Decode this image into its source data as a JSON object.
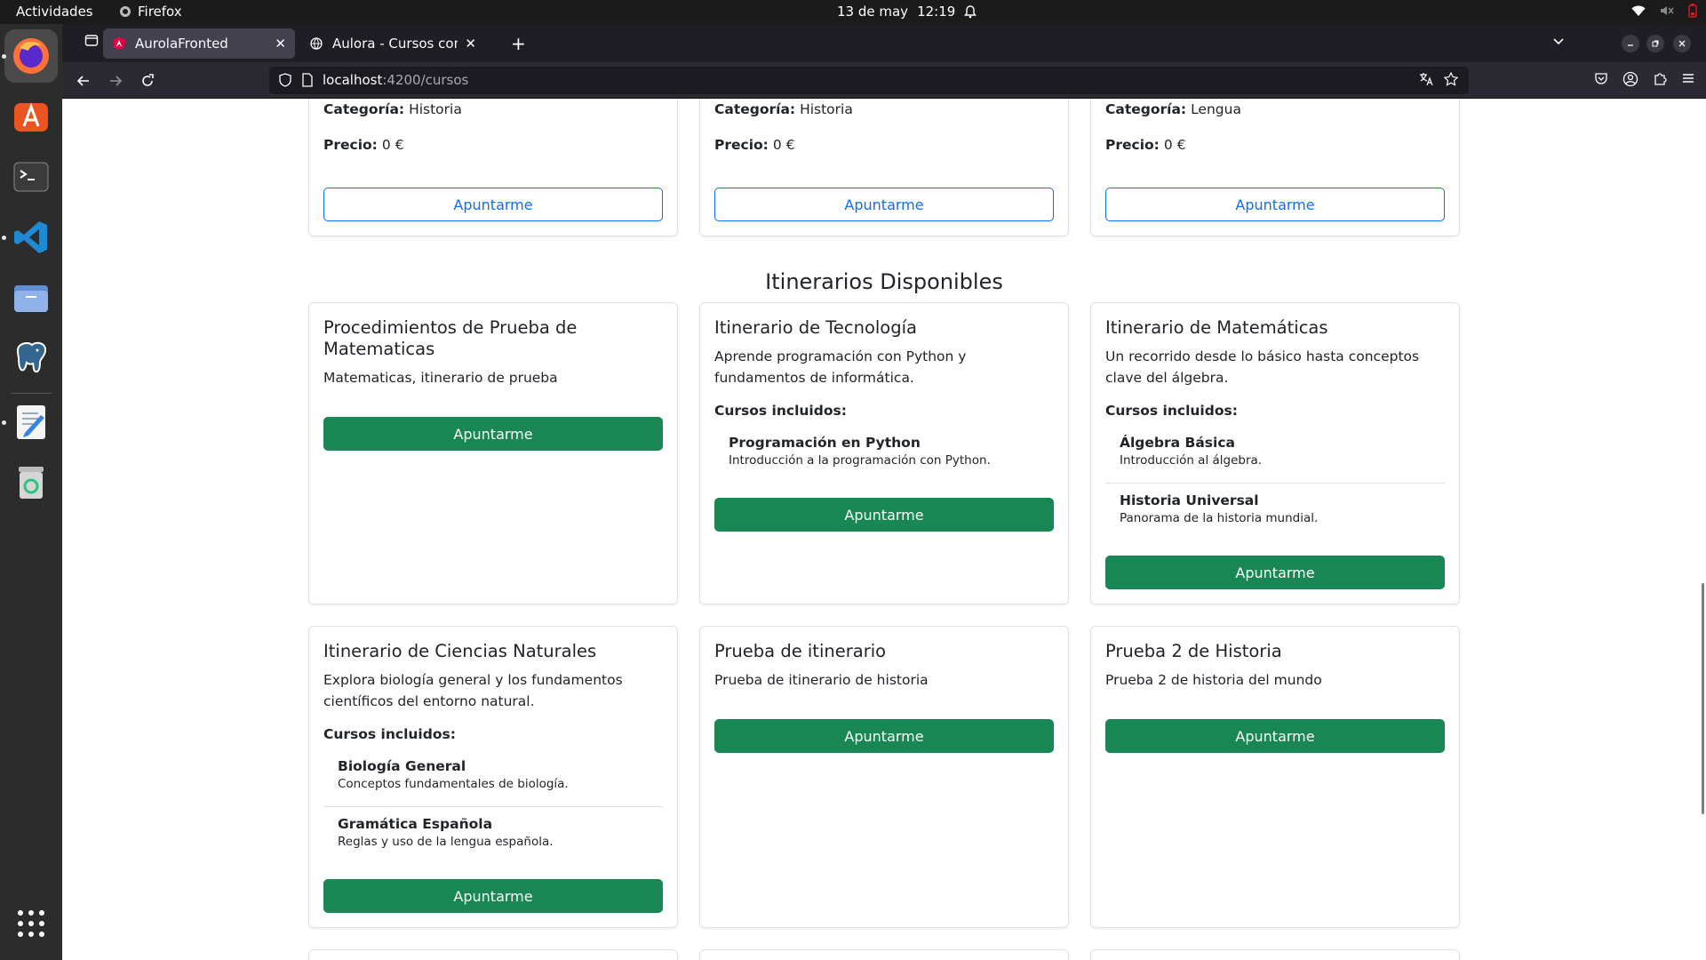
{
  "os": {
    "activities": "Actividades",
    "app_name": "Firefox",
    "date": "13 de may",
    "time": "12:19"
  },
  "browser": {
    "tabs": [
      {
        "title": "AurolaFronted",
        "active": true
      },
      {
        "title": "Aulora - Cursos completa",
        "active": false
      }
    ],
    "url_host": "localhost",
    "url_path": ":4200/cursos"
  },
  "page": {
    "labels": {
      "category": "Categoría:",
      "price": "Precio:",
      "included": "Cursos incluidos:",
      "enroll": "Apuntarme"
    },
    "top_courses": [
      {
        "category": "Historia",
        "price": "0 €"
      },
      {
        "category": "Historia",
        "price": "0 €"
      },
      {
        "category": "Lengua",
        "price": "0 €"
      }
    ],
    "section_title": "Itinerarios Disponibles",
    "itineraries": [
      {
        "title": "Procedimientos de Prueba de Matematicas",
        "description": "Matematicas, itinerario de prueba",
        "courses": []
      },
      {
        "title": "Itinerario de Tecnología",
        "description": "Aprende programación con Python y fundamentos de informática.",
        "courses": [
          {
            "title": "Programación en Python",
            "description": "Introducción a la programación con Python."
          }
        ]
      },
      {
        "title": "Itinerario de Matemáticas",
        "description": "Un recorrido desde lo básico hasta conceptos clave del álgebra.",
        "courses": [
          {
            "title": "Álgebra Básica",
            "description": "Introducción al álgebra."
          },
          {
            "title": "Historia Universal",
            "description": "Panorama de la historia mundial."
          }
        ]
      },
      {
        "title": "Itinerario de Ciencias Naturales",
        "description": "Explora biología general y los fundamentos científicos del entorno natural.",
        "courses": [
          {
            "title": "Biología General",
            "description": "Conceptos fundamentales de biología."
          },
          {
            "title": "Gramática Española",
            "description": "Reglas y uso de la lengua española."
          }
        ]
      },
      {
        "title": "Prueba de itinerario",
        "description": "Prueba de itinerario de historia",
        "courses": []
      },
      {
        "title": "Prueba 2 de Historia",
        "description": "Prueba 2 de historia del mundo",
        "courses": []
      }
    ]
  },
  "colors": {
    "primary": "#0d6efd",
    "success": "#198754",
    "topbar": "#1b1b1b",
    "dock": "#2c2c2c"
  }
}
